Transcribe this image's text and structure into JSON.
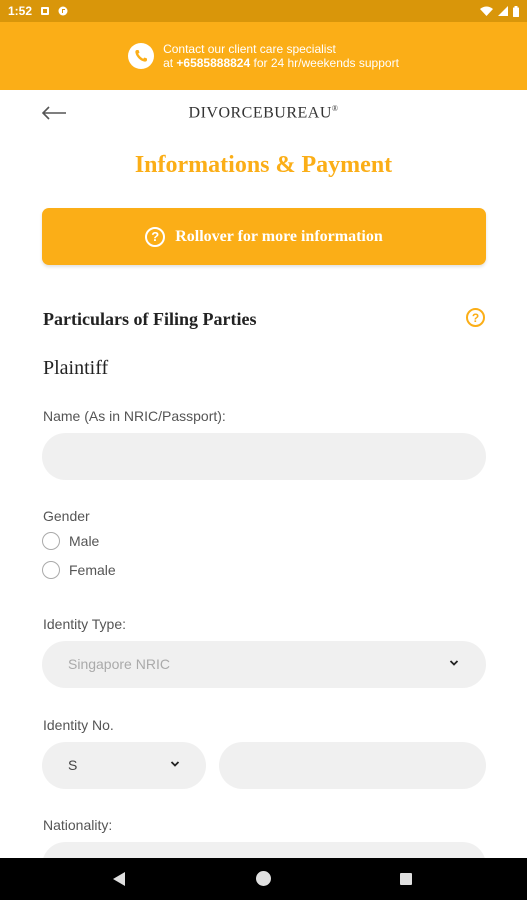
{
  "status_bar": {
    "time": "1:52"
  },
  "support": {
    "line1": "Contact our client care specialist",
    "line2_prefix": "at ",
    "phone": "+6585888824",
    "line2_suffix": " for 24 hr/weekends support"
  },
  "header": {
    "brand": "DIVORCEBUREAU",
    "brand_mark": "®"
  },
  "page": {
    "title": "Informations & Payment",
    "rollover_label": "Rollover for more information",
    "rollover_icon_glyph": "?"
  },
  "section": {
    "title": "Particulars of Filing Parties",
    "help_glyph": "?",
    "party": "Plaintiff"
  },
  "form": {
    "name_label": "Name (As in NRIC/Passport):",
    "name_value": "",
    "gender_label": "Gender",
    "gender_options": [
      "Male",
      "Female"
    ],
    "identity_type_label": "Identity Type:",
    "identity_type_value": "Singapore NRIC",
    "identity_no_label": "Identity No.",
    "identity_prefix_value": "S",
    "identity_no_value": "",
    "nationality_label": "Nationality:"
  },
  "colors": {
    "brand": "#fbae17",
    "status_bar": "#d9960a",
    "input_bg": "#f0f0f0"
  },
  "icons": {
    "status": [
      "notification-square-icon",
      "app-circle-icon",
      "wifi-icon",
      "signal-icon",
      "battery-icon"
    ],
    "banner": "phone-support-icon",
    "back": "arrow-left-icon",
    "select": "chevron-down-icon",
    "nav": [
      "nav-back-icon",
      "nav-home-icon",
      "nav-recents-icon"
    ]
  }
}
